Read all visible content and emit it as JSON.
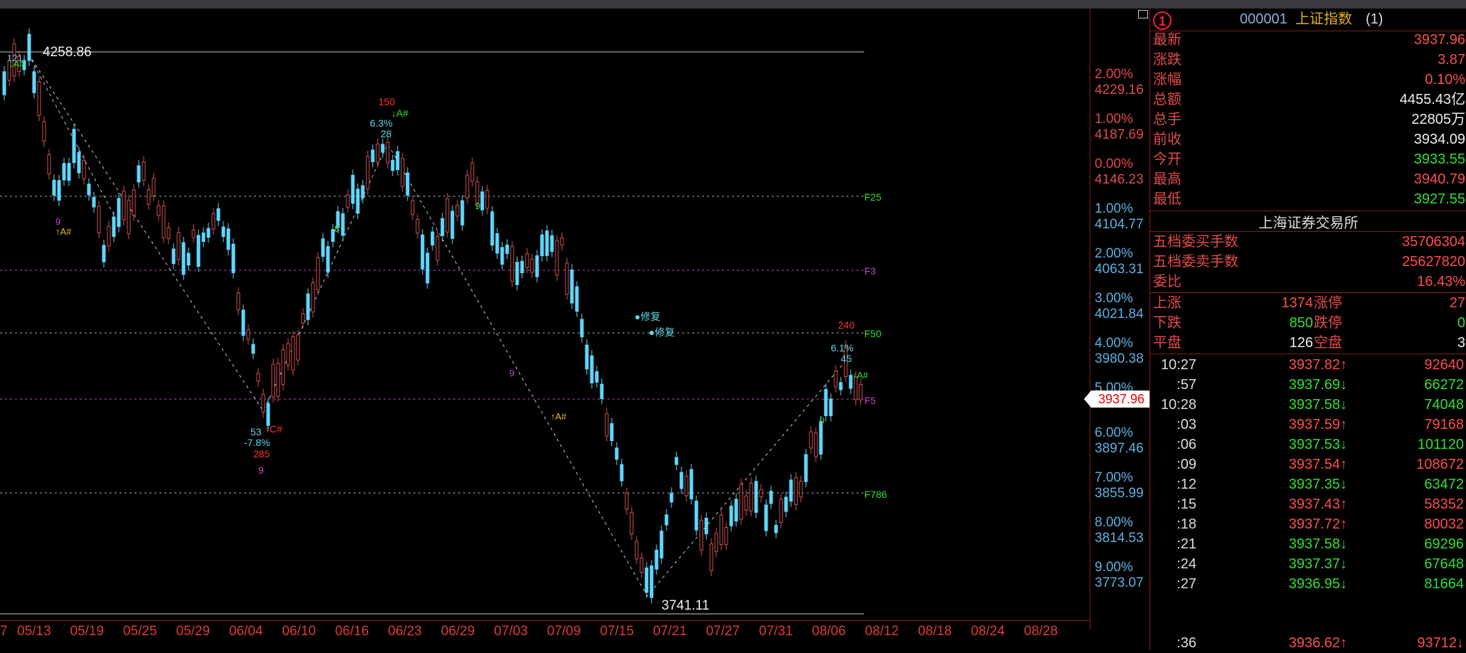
{
  "colors": {
    "up": "#ff4d4d",
    "down": "#2fe02f",
    "accent_blue": "#5fb0e0",
    "frame": "#8a1a1a"
  },
  "header": {
    "badge": "1",
    "code": "000001",
    "name": "上证指数",
    "suffix": "(1)"
  },
  "quote": {
    "latest_label": "最新",
    "latest": "3937.96",
    "change_label": "涨跌",
    "change": "3.87",
    "pct_label": "涨幅",
    "pct": "0.10%",
    "amount_label": "总额",
    "amount": "4455.43亿",
    "volume_label": "总手",
    "volume": "22805万",
    "prev_label": "前收",
    "prev": "3934.09",
    "open_label": "今开",
    "open": "3933.55",
    "high_label": "最高",
    "high": "3940.79",
    "low_label": "最低",
    "low": "3927.55"
  },
  "exchange": "上海证券交易所",
  "orders": {
    "buy_label": "五档委买手数",
    "buy": "35706304",
    "sell_label": "五档委卖手数",
    "sell": "25627820",
    "ratio_label": "委比",
    "ratio": "16.43%"
  },
  "breadth": {
    "up_label": "上涨",
    "up": "1374",
    "limit_up_label": "涨停",
    "limit_up": "27",
    "down_label": "下跌",
    "down": "850",
    "limit_down_label": "跌停",
    "limit_down": "0",
    "flat_label": "平盘",
    "flat": "126",
    "suspended_label": "空盘",
    "suspended": "3"
  },
  "ticks": [
    {
      "time": "10:27",
      "price": "3937.82↑",
      "vol": "92640",
      "dir": "up"
    },
    {
      "time": ":57",
      "price": "3937.69↓",
      "vol": "66272",
      "dir": "down"
    },
    {
      "time": "10:28",
      "price": "3937.58↓",
      "vol": "74048",
      "dir": "down"
    },
    {
      "time": ":03",
      "price": "3937.59↑",
      "vol": "79168",
      "dir": "up"
    },
    {
      "time": ":06",
      "price": "3937.53↓",
      "vol": "101120",
      "dir": "down"
    },
    {
      "time": ":09",
      "price": "3937.54↑",
      "vol": "108672",
      "dir": "up"
    },
    {
      "time": ":12",
      "price": "3937.35↓",
      "vol": "63472",
      "dir": "down"
    },
    {
      "time": ":15",
      "price": "3937.43↑",
      "vol": "58352",
      "dir": "up"
    },
    {
      "time": ":18",
      "price": "3937.72↑",
      "vol": "80032",
      "dir": "up"
    },
    {
      "time": ":21",
      "price": "3937.58↓",
      "vol": "69296",
      "dir": "down"
    },
    {
      "time": ":24",
      "price": "3937.37↓",
      "vol": "67648",
      "dir": "down"
    },
    {
      "time": ":27",
      "price": "3936.95↓",
      "vol": "81664",
      "dir": "down"
    },
    {
      "time": ":36",
      "price": "3936.62↑",
      "vol": "93712↓",
      "dir": "up"
    }
  ],
  "scale": [
    {
      "pct": "2.00%",
      "price": "4229.16",
      "color": "red"
    },
    {
      "pct": "1.00%",
      "price": "4187.69",
      "color": "red"
    },
    {
      "pct": "0.00%",
      "price": "4146.23",
      "color": "red"
    },
    {
      "pct": "1.00%",
      "price": "4104.77",
      "color": "blue"
    },
    {
      "pct": "2.00%",
      "price": "4063.31",
      "color": "blue"
    },
    {
      "pct": "3.00%",
      "price": "4021.84",
      "color": "blue"
    },
    {
      "pct": "4.00%",
      "price": "3980.38",
      "color": "blue"
    },
    {
      "pct": "5.00%",
      "price": "3938.92",
      "color": "blue"
    },
    {
      "pct": "6.00%",
      "price": "3897.46",
      "color": "blue"
    },
    {
      "pct": "7.00%",
      "price": "3855.99",
      "color": "blue"
    },
    {
      "pct": "8.00%",
      "price": "3814.53",
      "color": "blue"
    },
    {
      "pct": "9.00%",
      "price": "3773.07",
      "color": "blue"
    }
  ],
  "current_price_tag": "3937.96",
  "xaxis": [
    "7",
    "05/13",
    "05/19",
    "05/25",
    "05/29",
    "06/04",
    "06/10",
    "06/16",
    "06/23",
    "06/29",
    "07/03",
    "07/09",
    "07/15",
    "07/21",
    "07/27",
    "07/31",
    "08/06",
    "08/12",
    "08/18",
    "08/24",
    "08/28"
  ],
  "chart_labels": {
    "high_price": "4258.86",
    "low_price": "3741.11",
    "fib": [
      "F25",
      "F3",
      "F50",
      "F5",
      "F786"
    ],
    "repair1": "●修复",
    "repair2": "●修复",
    "a1": "↑A#",
    "a2": "↑A#",
    "a_top": "↓A#",
    "a_right": "↓A#",
    "c1": "↑C#",
    "a_left": "↓A#",
    "n150": "150",
    "n63": "6.3%",
    "n28": "28",
    "n53": "53",
    "n78": "-7.8%",
    "n285": "285",
    "n9": "9",
    "n8": "8",
    "n240": "240",
    "n61": "6.1%",
    "n45": "45",
    "n121": "121"
  }
}
